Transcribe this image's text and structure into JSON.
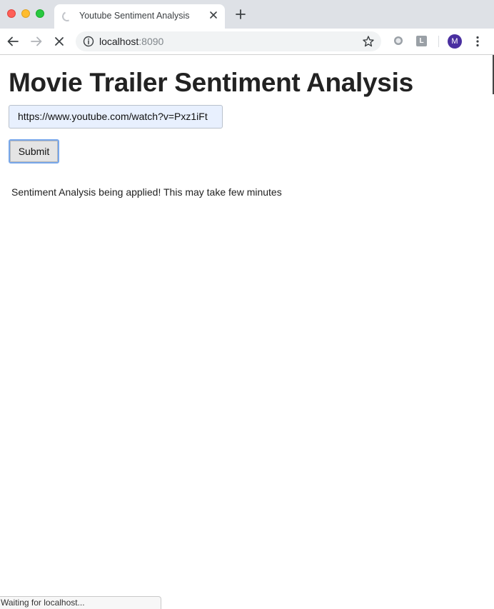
{
  "browser": {
    "tab": {
      "title": "Youtube Sentiment Analysis",
      "close_icon": "close-icon",
      "loading_icon": "loading-spinner-icon"
    },
    "new_tab_icon": "plus-icon",
    "address_bar": {
      "host": "localhost",
      "port": ":8090",
      "info_icon": "info-icon",
      "bookmark_icon": "star-icon"
    },
    "extensions": {
      "first_icon": "circle-extension-icon",
      "second_label": "L"
    },
    "profile": {
      "initial": "M",
      "color": "#4a2fa0"
    },
    "status_bar_text": "Waiting for localhost..."
  },
  "page": {
    "title": "Movie Trailer Sentiment Analysis",
    "url_input_value": "https://www.youtube.com/watch?v=Pxz1iFt",
    "submit_label": "Submit",
    "status_message": "Sentiment Analysis being applied! This may take few minutes"
  },
  "colors": {
    "tabstrip_bg": "#dee1e6",
    "input_autofill_bg": "#e8f0fe",
    "button_focus_ring": "#78a7ea",
    "title_text": "#222222"
  }
}
